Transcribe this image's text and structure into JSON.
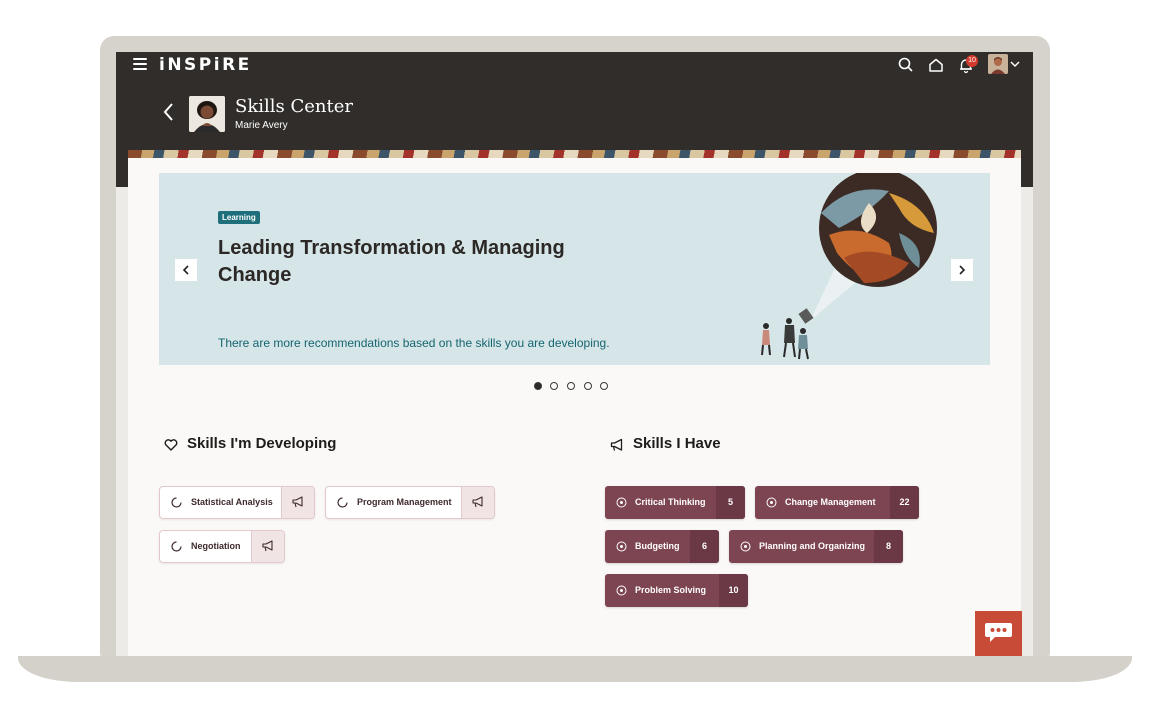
{
  "app": {
    "brand": "iNSPiRE",
    "notifications": "10"
  },
  "page": {
    "title": "Skills Center",
    "subtitle": "Marie Avery"
  },
  "hero": {
    "tag": "Learning",
    "title": "Leading Transformation & Managing Change",
    "note": "There are more recommendations based on the skills you are developing.",
    "slides": 5,
    "active_slide": 1
  },
  "developing": {
    "heading": "Skills I'm Developing",
    "chips": [
      {
        "label": "Statistical Analysis"
      },
      {
        "label": "Program Management"
      },
      {
        "label": "Negotiation"
      }
    ]
  },
  "have": {
    "heading": "Skills I Have",
    "chips": [
      {
        "label": "Critical Thinking",
        "count": "5"
      },
      {
        "label": "Change Management",
        "count": "22"
      },
      {
        "label": "Budgeting",
        "count": "6"
      },
      {
        "label": "Planning and Organizing",
        "count": "8"
      },
      {
        "label": "Problem Solving",
        "count": "10"
      }
    ]
  },
  "colors": {
    "header": "#312d2a",
    "accent_teal": "#1e6f7b",
    "chip_dark": "#7d4552",
    "chat": "#c84b38"
  },
  "icons": [
    "menu-icon",
    "search-icon",
    "home-icon",
    "bell-icon",
    "chevron-down-icon",
    "back-chevron-icon",
    "heart-icon",
    "megaphone-icon",
    "spinner-icon",
    "skill-badge-icon",
    "chat-icon",
    "chevron-left-icon",
    "chevron-right-icon"
  ]
}
